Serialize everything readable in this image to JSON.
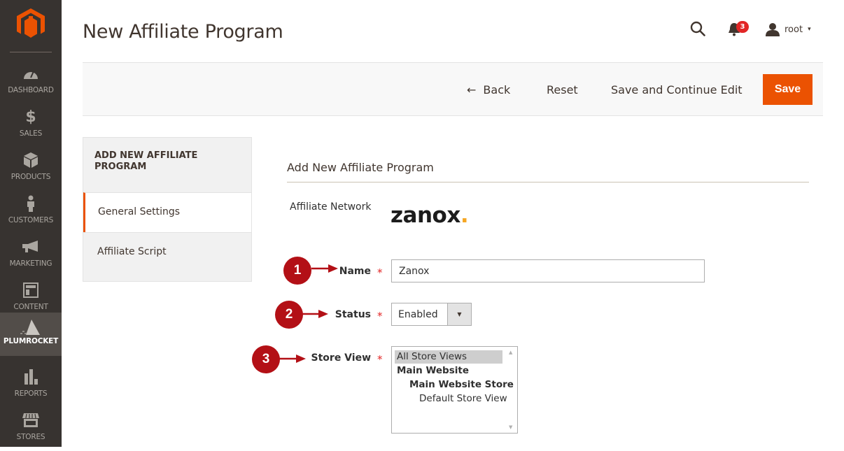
{
  "sidebar": {
    "logo": "magento-logo",
    "items": [
      {
        "label": "DASHBOARD",
        "icon": "dashboard-icon",
        "active": false
      },
      {
        "label": "SALES",
        "icon": "dollar-icon",
        "active": false
      },
      {
        "label": "PRODUCTS",
        "icon": "box-icon",
        "active": false
      },
      {
        "label": "CUSTOMERS",
        "icon": "person-icon",
        "active": false
      },
      {
        "label": "MARKETING",
        "icon": "megaphone-icon",
        "active": false
      },
      {
        "label": "CONTENT",
        "icon": "layout-icon",
        "active": false
      },
      {
        "label": "PLUMROCKET",
        "icon": "plumrocket-icon",
        "active": true
      },
      {
        "label": "REPORTS",
        "icon": "bar-chart-icon",
        "active": false
      },
      {
        "label": "STORES",
        "icon": "storefront-icon",
        "active": false
      }
    ]
  },
  "header": {
    "title": "New Affiliate Program",
    "notifications_count": "3",
    "username": "root",
    "caret": "▾"
  },
  "actions": {
    "back_icon": "←",
    "back_label": "Back",
    "reset_label": "Reset",
    "save_continue_label": "Save and Continue Edit",
    "save_label": "Save"
  },
  "tabs": {
    "title": "ADD NEW AFFILIATE PROGRAM",
    "items": [
      {
        "label": "General Settings",
        "active": true
      },
      {
        "label": "Affiliate Script",
        "active": false
      }
    ]
  },
  "form": {
    "section_title": "Add New Affiliate Program",
    "network_label": "Affiliate Network",
    "network_logo_text": "zanox",
    "network_logo_dot": ".",
    "required_mark": "*",
    "name": {
      "label": "Name",
      "value": "Zanox"
    },
    "status": {
      "label": "Status",
      "value": "Enabled",
      "arrow": "▼"
    },
    "store_view": {
      "label": "Store View",
      "options": [
        {
          "label": "All Store Views",
          "selected": true,
          "bold": false,
          "indent": 0
        },
        {
          "label": "Main Website",
          "selected": false,
          "bold": true,
          "indent": 0
        },
        {
          "label": "Main Website Store",
          "selected": false,
          "bold": true,
          "indent": 1
        },
        {
          "label": "Default Store View",
          "selected": false,
          "bold": false,
          "indent": 2
        }
      ],
      "scroll_up": "▲",
      "scroll_down": "▼"
    }
  },
  "callouts": [
    "1",
    "2",
    "3"
  ],
  "colors": {
    "accent": "#eb5202",
    "sidebar_bg": "#373330",
    "callout": "#b31016",
    "badge": "#e22626"
  }
}
